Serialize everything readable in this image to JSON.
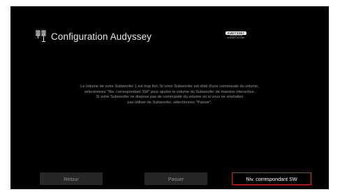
{
  "header": {
    "title": "Configuration Audyssey",
    "icon": "speaker-setup-icon"
  },
  "logo": {
    "brand": "AUDYSSEY",
    "line1": "MULTEQ XT32",
    "line2": "DYNAMIC VOLUME"
  },
  "message": {
    "lines": [
      "Le volume de votre Subwoofer 1 est trop fort. Si votre Subwoofer est doté d'une commande du volume,",
      "sélectionnez \"Niv. correspondant SW\" pour ajuster le volume du Subwoofer de manière interactive.",
      "Si votre Subwoofer ne dispose pas de commande du volume ou si vous ne souhaitez",
      "pas utiliser de Subwoofer, sélectionnez \"Passer\"."
    ]
  },
  "buttons": {
    "back": "Retour",
    "skip": "Passer",
    "level_match": "Niv. correspondant SW"
  },
  "colors": {
    "background": "#000000",
    "focus_border": "#e0202a",
    "button_bg": "#262626"
  }
}
